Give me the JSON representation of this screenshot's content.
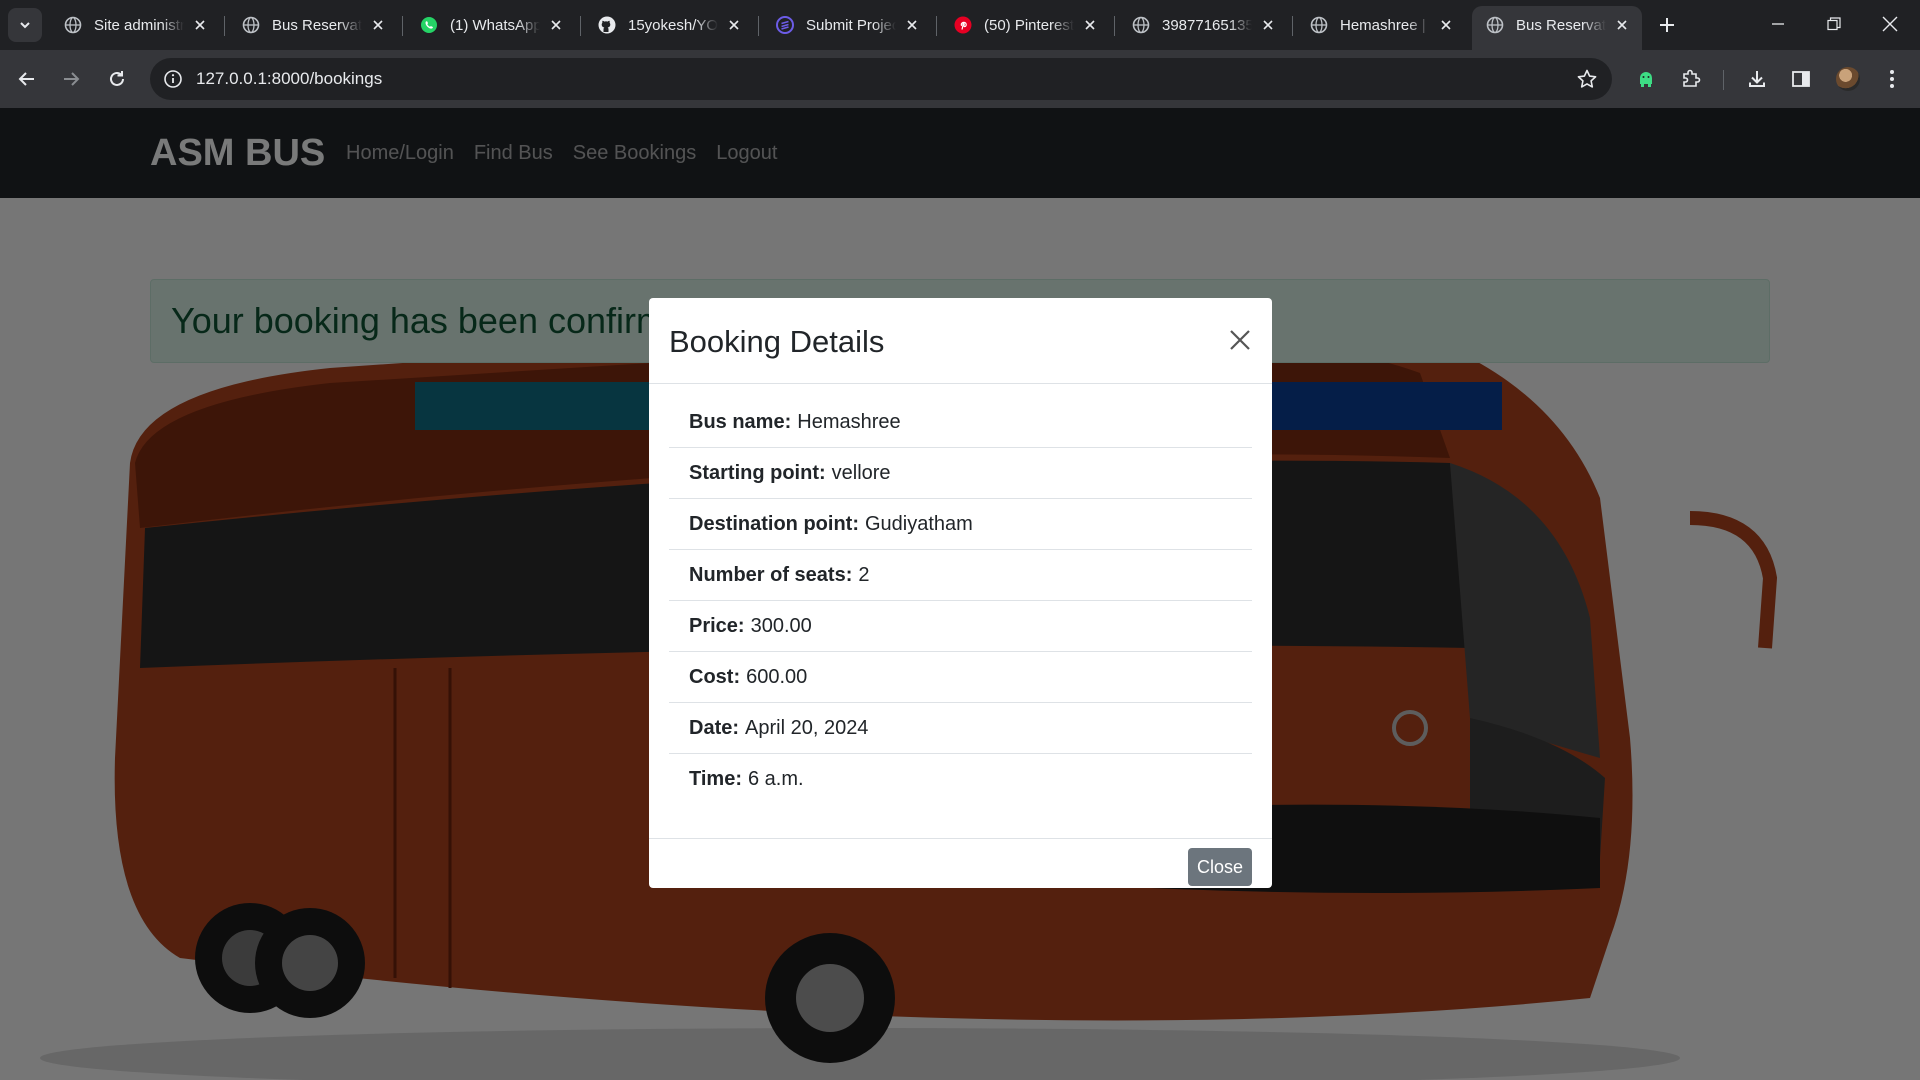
{
  "browser": {
    "tabs": [
      {
        "title": "Site administr",
        "icon": "globe-icon"
      },
      {
        "title": "Bus Reservatio",
        "icon": "globe-icon"
      },
      {
        "title": "(1) WhatsApp",
        "icon": "whatsapp-icon"
      },
      {
        "title": "15yokesh/YO",
        "icon": "github-icon"
      },
      {
        "title": "Submit Projec",
        "icon": "stack-icon"
      },
      {
        "title": "(50) Pinterest",
        "icon": "pinterest-icon"
      },
      {
        "title": "39877165135",
        "icon": "globe-icon"
      },
      {
        "title": "Hemashree |",
        "icon": "globe-icon"
      },
      {
        "title": "Bus Reservatio",
        "icon": "globe-icon",
        "active": true
      }
    ],
    "url": "127.0.0.1:8000/bookings"
  },
  "navbar": {
    "brand": "ASM BUS",
    "links": [
      "Home/Login",
      "Find Bus",
      "See Bookings",
      "Logout"
    ]
  },
  "alert": {
    "text": "Your booking has been confirmed"
  },
  "modal": {
    "title": "Booking Details",
    "fields": [
      {
        "label": "Bus name:",
        "value": "Hemashree"
      },
      {
        "label": "Starting point:",
        "value": "vellore"
      },
      {
        "label": "Destination point:",
        "value": "Gudiyatham"
      },
      {
        "label": "Number of seats:",
        "value": "2"
      },
      {
        "label": "Price:",
        "value": "300.00"
      },
      {
        "label": "Cost:",
        "value": "600.00"
      },
      {
        "label": "Date:",
        "value": "April 20, 2024"
      },
      {
        "label": "Time:",
        "value": "6 a.m."
      }
    ],
    "close_label": "Close"
  }
}
